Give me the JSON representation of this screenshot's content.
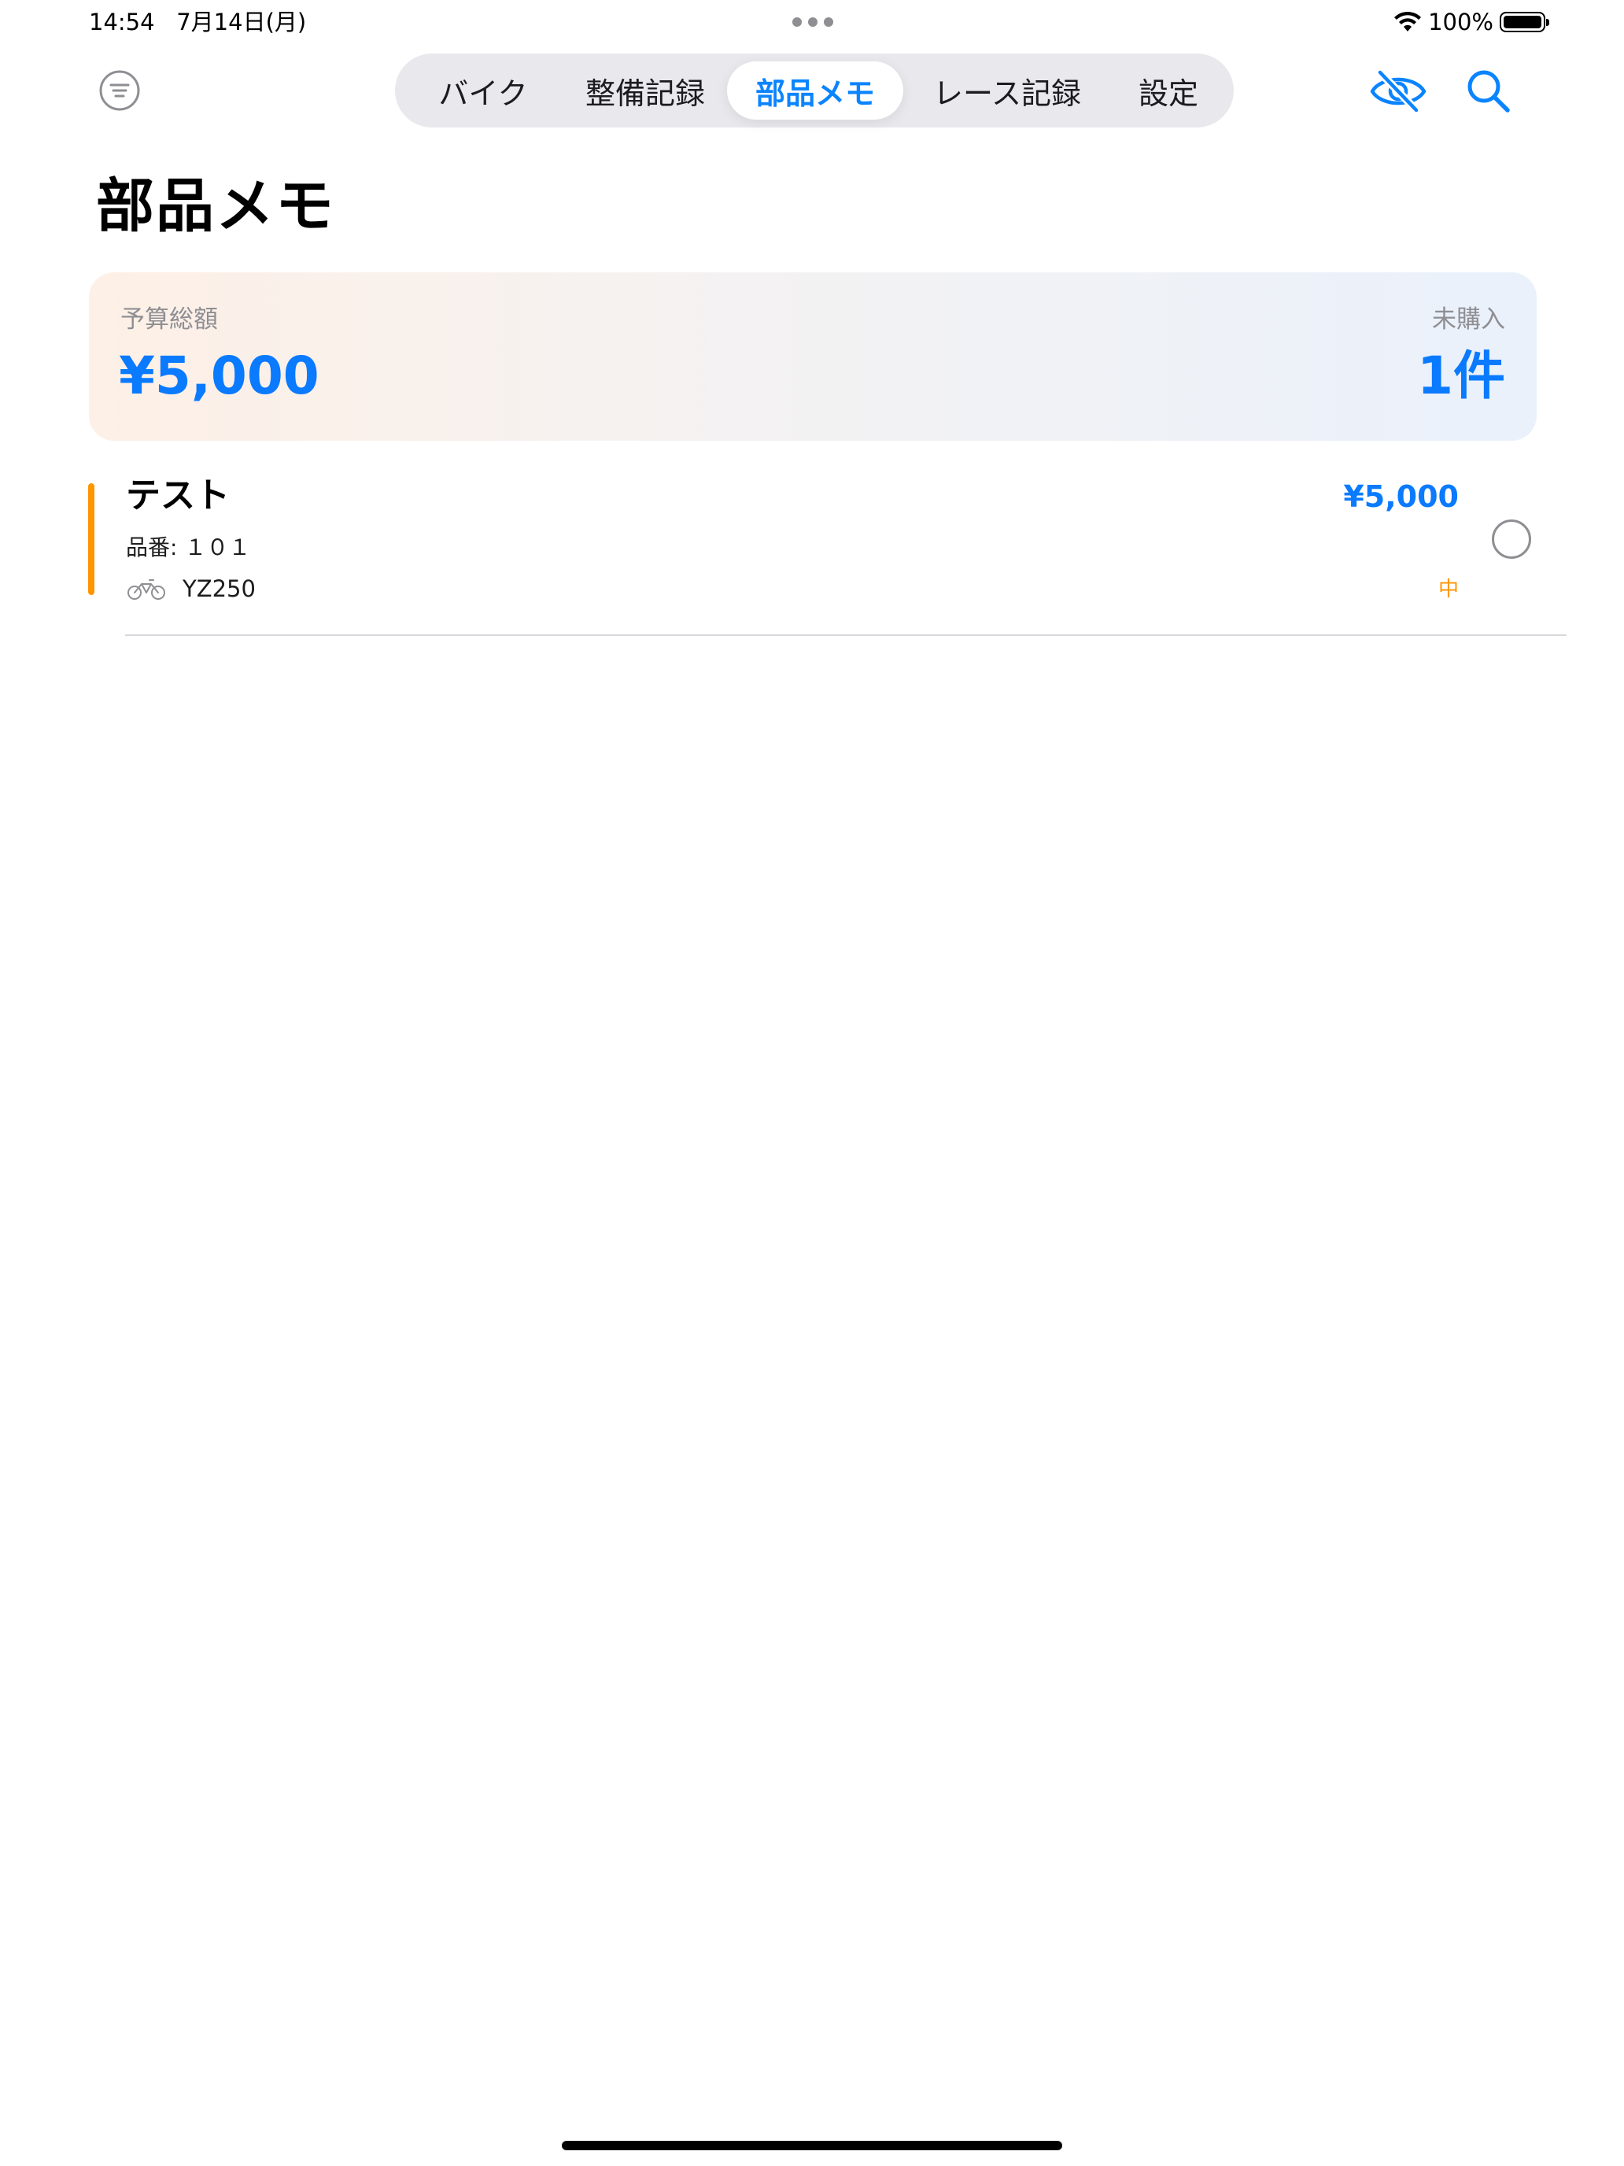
{
  "status_bar": {
    "time": "14:54",
    "date": "7月14日(月)",
    "battery_percent": "100%",
    "battery_level": 1.0,
    "wifi_icon": "wifi-icon"
  },
  "toolbar": {
    "menu_icon": "list-circle-icon",
    "tabs": [
      {
        "label": "バイク",
        "active": false
      },
      {
        "label": "整備記録",
        "active": false
      },
      {
        "label": "部品メモ",
        "active": true
      },
      {
        "label": "レース記録",
        "active": false
      },
      {
        "label": "設定",
        "active": false
      }
    ],
    "visibility_icon": "eye-slash-icon",
    "search_icon": "magnifying-glass-icon",
    "accent_color": "#0a84ff"
  },
  "page": {
    "title": "部品メモ"
  },
  "summary": {
    "budget_label": "予算総額",
    "budget_value": "¥5,000",
    "unpurchased_label": "未購入",
    "unpurchased_value": "1件"
  },
  "parts": [
    {
      "name": "テスト",
      "part_number": "品番: １０１",
      "price": "¥5,000",
      "bike": "YZ250",
      "bike_icon": "motorcycle-icon",
      "priority": "中",
      "priority_color": "#ff9500",
      "purchased": false
    }
  ]
}
